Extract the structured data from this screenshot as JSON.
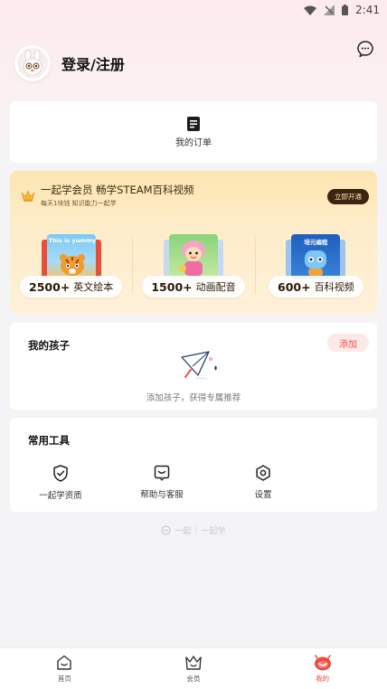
{
  "status_bar": {
    "time": "2:41",
    "icons": [
      "wifi-icon",
      "signal-icon",
      "battery-icon"
    ]
  },
  "header": {
    "login_label": "登录/注册",
    "message_icon": "chat-bubble-icon"
  },
  "orders": {
    "label": "我的订单",
    "icon": "order-list-icon"
  },
  "vip": {
    "title": "一起学会员 畅学STEAM百科视频",
    "subtitle": "每天1块钱 知识能力一起学",
    "open_button": "立即开通",
    "items": [
      {
        "count": "2500+",
        "label": "英文绘本",
        "thumb_text": "This is yummy"
      },
      {
        "count": "1500+",
        "label": "动画配音"
      },
      {
        "count": "600+",
        "label": "百科视频",
        "thumb_text": "培元编程"
      }
    ]
  },
  "kids": {
    "title": "我的孩子",
    "add_button": "添加",
    "hint": "添加孩子，获得专属推荐"
  },
  "tools": {
    "title": "常用工具",
    "items": [
      {
        "label": "一起学资质",
        "icon": "shield-check-icon"
      },
      {
        "label": "帮助与客服",
        "icon": "customer-service-icon"
      },
      {
        "label": "设置",
        "icon": "settings-gear-icon"
      }
    ]
  },
  "brand": {
    "left": "一起",
    "right": "一起学"
  },
  "tabbar": {
    "tabs": [
      {
        "label": "首页",
        "icon": "home-icon",
        "active": false
      },
      {
        "label": "会员",
        "icon": "crown-basket-icon",
        "active": false
      },
      {
        "label": "我的",
        "icon": "smile-icon",
        "active": true
      }
    ]
  },
  "colors": {
    "accent": "#f2483e",
    "vip_dark": "#3b2410",
    "vip_bg": "#fde5b0"
  }
}
